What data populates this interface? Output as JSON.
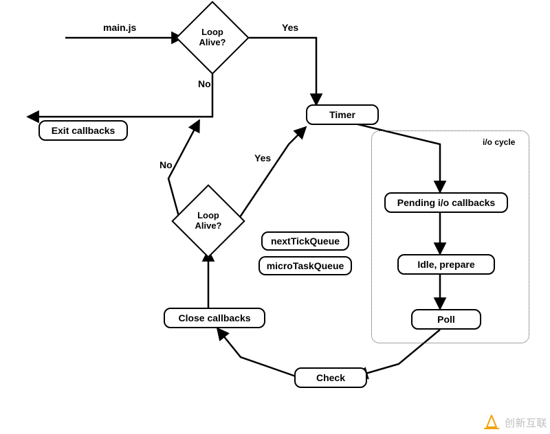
{
  "diagram": {
    "entry_label": "main.js",
    "decisions": {
      "loop_alive_top": "Loop\nAlive?",
      "loop_alive_bottom": "Loop\nAlive?"
    },
    "branches": {
      "yes_top": "Yes",
      "no_top": "No",
      "yes_bottom": "Yes",
      "no_bottom": "No"
    },
    "nodes": {
      "exit_callbacks": "Exit callbacks",
      "timer": "Timer",
      "pending_io": "Pending i/o callbacks",
      "idle_prepare": "Idle, prepare",
      "poll": "Poll",
      "check": "Check",
      "close_callbacks": "Close callbacks",
      "next_tick_queue": "nextTickQueue",
      "micro_task_queue": "microTaskQueue"
    },
    "io_cycle_label": "i/o cycle"
  },
  "watermark": {
    "brand": "创新互联"
  }
}
